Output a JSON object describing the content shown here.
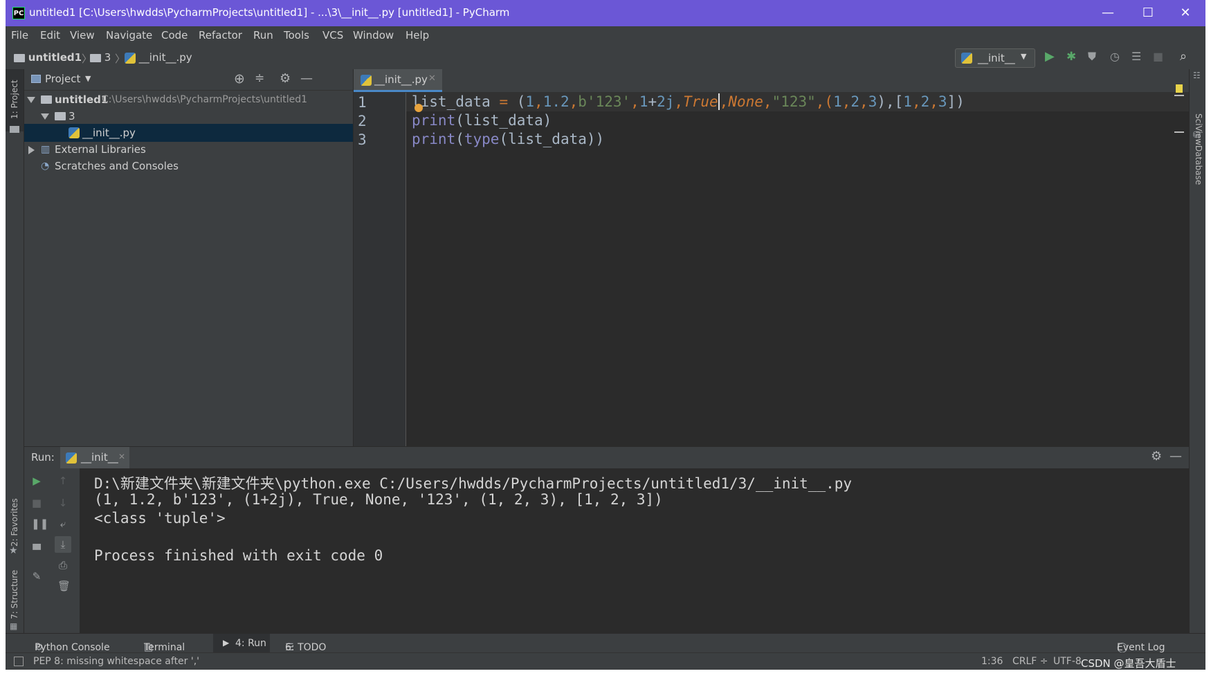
{
  "window": {
    "title": "untitled1 [C:\\Users\\hwdds\\PycharmProjects\\untitled1] - ...\\3\\__init__.py [untitled1] - PyCharm",
    "app_icon": "PC",
    "minimize": "—",
    "maximize": "☐",
    "close": "✕"
  },
  "menu": [
    "File",
    "Edit",
    "View",
    "Navigate",
    "Code",
    "Refactor",
    "Run",
    "Tools",
    "VCS",
    "Window",
    "Help"
  ],
  "breadcrumb": {
    "project": "untitled1",
    "folder": "3",
    "file": "__init__.py"
  },
  "run_config": {
    "label": "__init__"
  },
  "project_panel": {
    "title": "Project",
    "root_name": "untitled1",
    "root_path": "C:\\Users\\hwdds\\PycharmProjects\\untitled1",
    "folder": "3",
    "file": "__init__.py",
    "external_libraries": "External Libraries",
    "scratches": "Scratches and Consoles"
  },
  "left_strip": {
    "project": "1: Project",
    "favorites": "2: Favorites",
    "structure": "7: Structure"
  },
  "right_strip": {
    "sciview": "SciView",
    "database": "Database"
  },
  "editor": {
    "tab": "__init__.py",
    "line_numbers": [
      "1",
      "2",
      "3"
    ],
    "line1": {
      "name": "list_data ",
      "eq": "=",
      "p0": " (",
      "n1": "1",
      "c1": ",",
      "n2": "1.2",
      "c2": ",",
      "b": "b'123'",
      "c3": ",",
      "n3": "1",
      "plus": "+",
      "n4": "2j",
      "c4": ",",
      "t": "True",
      "c5": ",",
      "none": "None",
      "c6": ",",
      "s": "\"123\"",
      "c7": ",(",
      "t1": "1",
      "c8": ",",
      "t2": "2",
      "c9": ",",
      "t3": "3",
      "c10": "),[",
      "l1": "1",
      "c11": ",",
      "l2": "2",
      "c12": ",",
      "l3": "3",
      "end": "])"
    },
    "line2": {
      "fn": "print",
      "rest": "(list_data)"
    },
    "line3": {
      "fn": "print",
      "p": "(",
      "fn2": "type",
      "rest": "(list_data))"
    }
  },
  "run_panel": {
    "label": "Run:",
    "tab": "__init__",
    "output": [
      "D:\\新建文件夹\\新建文件夹\\python.exe C:/Users/hwdds/PycharmProjects/untitled1/3/__init__.py",
      "(1, 1.2, b'123', (1+2j), True, None, '123', (1, 2, 3), [1, 2, 3])",
      "<class 'tuple'>",
      "",
      "Process finished with exit code 0"
    ]
  },
  "tool_tabs": {
    "python_console": "Python Console",
    "terminal": "Terminal",
    "run": "4: Run",
    "todo": "6: TODO",
    "event_log": "Event Log"
  },
  "status": {
    "message": "PEP 8: missing whitespace after ','",
    "position": "1:36",
    "line_sep": "CRLF ÷",
    "encoding": "UTF-8",
    "watermark": "CSDN @皇吾大盾士"
  },
  "colors": {
    "titlebar": "#6b57d6",
    "editor_bg": "#2b2b2b",
    "panel_bg": "#3c3f41",
    "number": "#6897bb",
    "string": "#6a8759",
    "keyword": "#cc7832",
    "builtin": "#8888c6"
  }
}
